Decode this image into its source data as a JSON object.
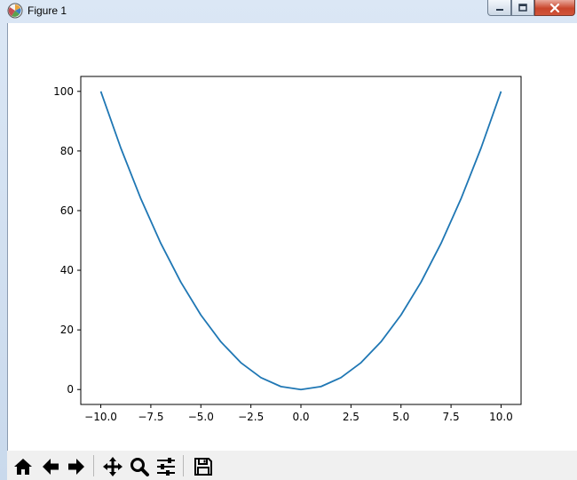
{
  "window": {
    "title": "Figure 1"
  },
  "toolbar": {
    "buttons": [
      {
        "name": "home-button",
        "icon": "home-icon"
      },
      {
        "name": "back-button",
        "icon": "arrow-left-icon"
      },
      {
        "name": "forward-button",
        "icon": "arrow-right-icon"
      },
      {
        "name": "pan-button",
        "icon": "move-icon"
      },
      {
        "name": "zoom-button",
        "icon": "magnifier-icon"
      },
      {
        "name": "configure-subplots-button",
        "icon": "sliders-icon"
      },
      {
        "name": "save-button",
        "icon": "floppy-disk-icon"
      }
    ]
  },
  "chart_data": {
    "type": "line",
    "title": "",
    "xlabel": "",
    "ylabel": "",
    "xlim": [
      -11,
      11
    ],
    "ylim": [
      -5,
      105
    ],
    "x_ticks": [
      -10,
      -7.5,
      -5,
      -2.5,
      0,
      2.5,
      5,
      7.5,
      10
    ],
    "x_tick_labels": [
      "−10.0",
      "−7.5",
      "−5.0",
      "−2.5",
      "0.0",
      "2.5",
      "5.0",
      "7.5",
      "10.0"
    ],
    "y_ticks": [
      0,
      20,
      40,
      60,
      80,
      100
    ],
    "y_tick_labels": [
      "0",
      "20",
      "40",
      "60",
      "80",
      "100"
    ],
    "grid": false,
    "series": [
      {
        "color": "#1f77b4",
        "x": [
          -10,
          -9,
          -8,
          -7,
          -6,
          -5,
          -4,
          -3,
          -2,
          -1,
          0,
          1,
          2,
          3,
          4,
          5,
          6,
          7,
          8,
          9,
          10
        ],
        "y": [
          100,
          81,
          64,
          49,
          36,
          25,
          16,
          9,
          4,
          1,
          0,
          1,
          4,
          9,
          16,
          25,
          36,
          49,
          64,
          81,
          100
        ]
      }
    ]
  }
}
